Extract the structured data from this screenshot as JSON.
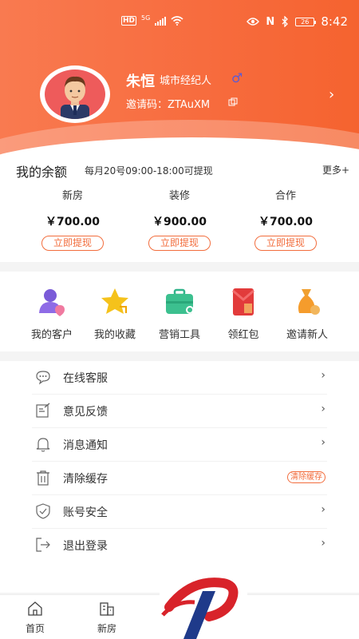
{
  "status_bar": {
    "hd": "HD",
    "network": "5G",
    "nfc": "N",
    "battery": "26",
    "time": "8:42"
  },
  "profile": {
    "name": "朱恒",
    "role": "城市经纪人",
    "gender_symbol": "♂",
    "invite_code": "邀请码：ZTAuXM",
    "arrow": "›"
  },
  "balance": {
    "title": "我的余额",
    "note": "每月20号09:00-18:00可提现",
    "more": "更多+",
    "accounts": [
      {
        "name": "新房",
        "amount": "￥700.00",
        "action": "立即提现"
      },
      {
        "name": "装修",
        "amount": "￥900.00",
        "action": "立即提现"
      },
      {
        "name": "合作",
        "amount": "￥700.00",
        "action": "立即提现"
      }
    ]
  },
  "quick_actions": [
    {
      "label": "我的客户",
      "icon": "customers-icon"
    },
    {
      "label": "我的收藏",
      "icon": "star-icon"
    },
    {
      "label": "营销工具",
      "icon": "toolbox-icon"
    },
    {
      "label": "领红包",
      "icon": "red-envelope-icon"
    },
    {
      "label": "邀请新人",
      "icon": "invite-icon"
    }
  ],
  "menu": [
    {
      "label": "在线客服",
      "icon": "chat-icon",
      "right": "›"
    },
    {
      "label": "意见反馈",
      "icon": "feedback-icon",
      "right": "›"
    },
    {
      "label": "消息通知",
      "icon": "bell-icon",
      "right": "›"
    },
    {
      "label": "清除缓存",
      "icon": "trash-icon",
      "tag": "清除缓存"
    },
    {
      "label": "账号安全",
      "icon": "shield-icon",
      "right": "›"
    },
    {
      "label": "退出登录",
      "icon": "logout-icon",
      "right": "›"
    }
  ],
  "bottom_nav": [
    {
      "label": "首页",
      "icon": "home-icon"
    },
    {
      "label": "新房",
      "icon": "building-icon"
    }
  ],
  "colors": {
    "accent": "#f26d3d",
    "header_start": "#f97a50",
    "header_end": "#f5632f"
  }
}
